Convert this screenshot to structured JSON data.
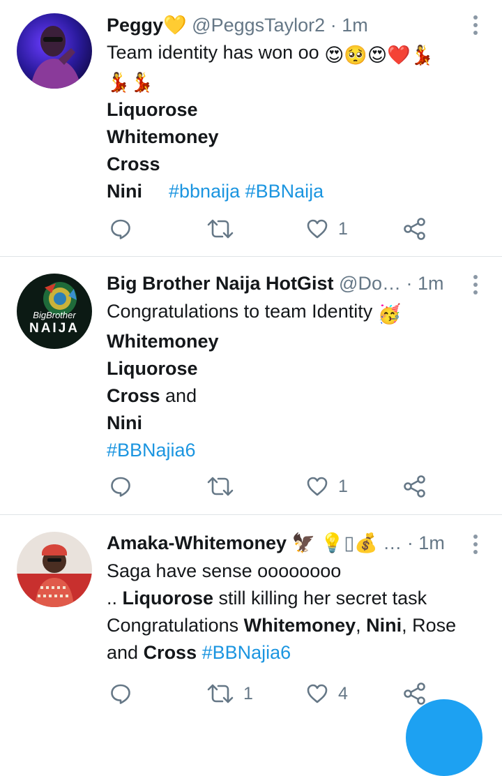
{
  "tweets": [
    {
      "name": "Peggy💛",
      "handle": "@PeggsTaylor2",
      "time": "· 1m",
      "line1": "Team identity has won oo",
      "line1_emoji": "😍🥺😍❤️💃",
      "line2_emoji": "💃💃",
      "names": [
        "Liquorose",
        "Whitemoney",
        "Cross",
        "Nini"
      ],
      "tags": "#bbnaija #BBNaija",
      "retweets": "",
      "likes": "1"
    },
    {
      "name": "Big Brother Naija HotGist",
      "handle": "@Do…",
      "time": "· 1m",
      "line1": "Congratulations to team Identity",
      "line1_emoji": "🥳",
      "names": [
        "Whitemoney",
        "Liquorose",
        "Cross",
        "Nini"
      ],
      "cross_suffix": " and",
      "tags": "#BBNajia6",
      "avatar_text_top": "BigBrother",
      "avatar_text_bottom": "NAIJA",
      "retweets": "",
      "likes": "1"
    },
    {
      "name": "Amaka-Whitemoney",
      "name_emoji": "🦅 💡▯💰 …",
      "time": "· 1m",
      "line1": "Saga have sense oooooooo",
      "line2_prefix": ".. ",
      "line2_bold": "Liquorose",
      "line2_rest": " still killing her secret task",
      "line3_prefix": "Congratulations ",
      "line3_b1": "Whitemoney",
      "line3_sep1": ", ",
      "line3_b2": "Nini",
      "line3_rest": ", Rose",
      "line4_prefix": "and ",
      "line4_bold": "Cross",
      "line4_tag": "#BBNajia6",
      "retweets": "1",
      "likes": "4"
    }
  ],
  "colors": {
    "link": "#1b95e0",
    "muted": "#657786",
    "fab": "#1da1f2"
  }
}
